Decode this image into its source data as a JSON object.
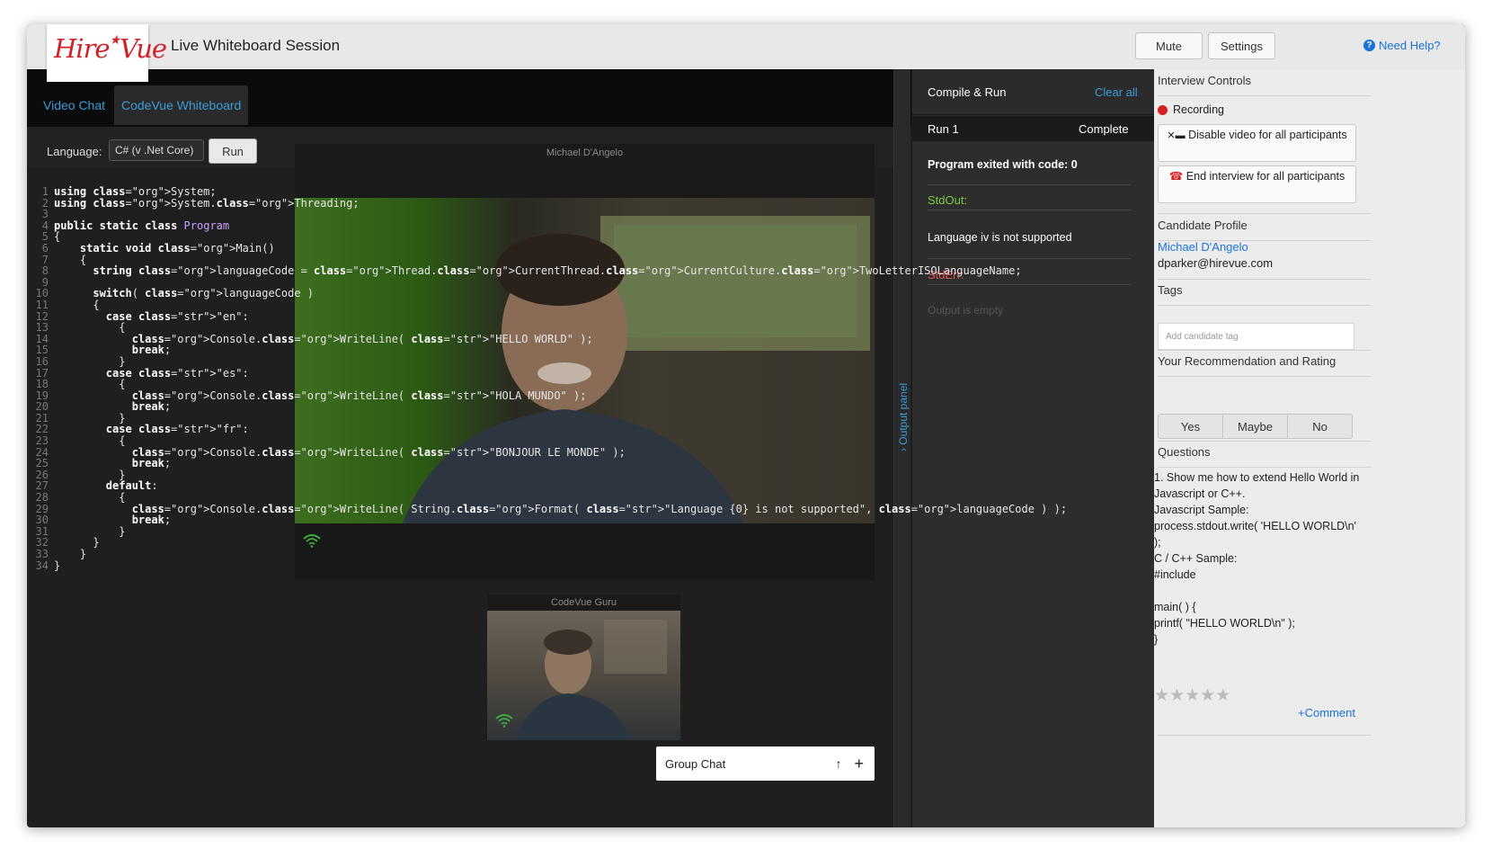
{
  "header": {
    "logo_text": "Hire Vue",
    "title": "Live Whiteboard Session",
    "mute_label": "Mute",
    "settings_label": "Settings",
    "help_label": "Need Help?"
  },
  "editor": {
    "tabs": [
      {
        "label": "Video Chat",
        "active": false
      },
      {
        "label": "CodeVue Whiteboard",
        "active": true
      }
    ],
    "language_label": "Language:",
    "language_value": "C# (v .Net Core)",
    "run_label": "Run",
    "code_lines": [
      "using System;",
      "using System.Threading;",
      "",
      "public static class Program",
      "{",
      "    static void Main()",
      "    {",
      "      string languageCode = Thread.CurrentThread.CurrentCulture.TwoLetterISOLanguageName;",
      "",
      "      switch( languageCode )",
      "      {",
      "        case \"en\":",
      "          {",
      "            Console.WriteLine( \"HELLO WORLD\" );",
      "            break;",
      "          }",
      "        case \"es\":",
      "          {",
      "            Console.WriteLine( \"HOLA MUNDO\" );",
      "            break;",
      "          }",
      "        case \"fr\":",
      "          {",
      "            Console.WriteLine( \"BONJOUR LE MONDE\" );",
      "            break;",
      "          }",
      "        default:",
      "          {",
      "            Console.WriteLine( String.Format( \"Language {0} is not supported\", languageCode ) );",
      "            break;",
      "          }",
      "      }",
      "    }",
      "}"
    ]
  },
  "video": {
    "main_name": "Michael D'Angelo",
    "small_name": "CodeVue Guru"
  },
  "output_panel_label": "Output panel",
  "group_chat": {
    "label": "Group Chat"
  },
  "compile": {
    "title": "Compile & Run",
    "clear_label": "Clear all",
    "run_label": "Run 1",
    "run_status": "Complete",
    "exit_text": "Program exited with code: 0",
    "stdout_label": "StdOut:",
    "stdout_text": "Language iv is not supported",
    "stderr_label": "StdErr:",
    "stderr_text": "Output is empty"
  },
  "controls": {
    "interview_controls": "Interview Controls",
    "recording_label": "Recording",
    "disable_video_label": "Disable video for all participants",
    "end_interview_label": "End interview for all participants",
    "candidate_profile": "Candidate Profile",
    "candidate_name": "Michael D'Angelo",
    "candidate_email": "dparker@hirevue.com",
    "tags_title": "Tags",
    "tag_placeholder": "Add candidate tag",
    "rating_title": "Your Recommendation and Rating",
    "rating_options": [
      "Yes",
      "Maybe",
      "No"
    ],
    "questions_title": "Questions",
    "question_lines": [
      "1.  Show me how to extend Hello World in Javascript or C++.",
      "",
      "Javascript Sample:",
      "process.stdout.write( 'HELLO WORLD\\n' );",
      "",
      "C / C++ Sample:",
      "#include",
      "",
      "main( ) {",
      "printf( \"HELLO WORLD\\n\" );",
      "}"
    ],
    "stars_value": 0,
    "stars_max": 5,
    "comment_label": "+Comment"
  },
  "colors": {
    "accent_blue": "#3c9ad9",
    "link_blue": "#1a73d9",
    "brand_red": "#d0222a",
    "stdout_green": "#7cc843",
    "stderr_red": "#e05555"
  }
}
